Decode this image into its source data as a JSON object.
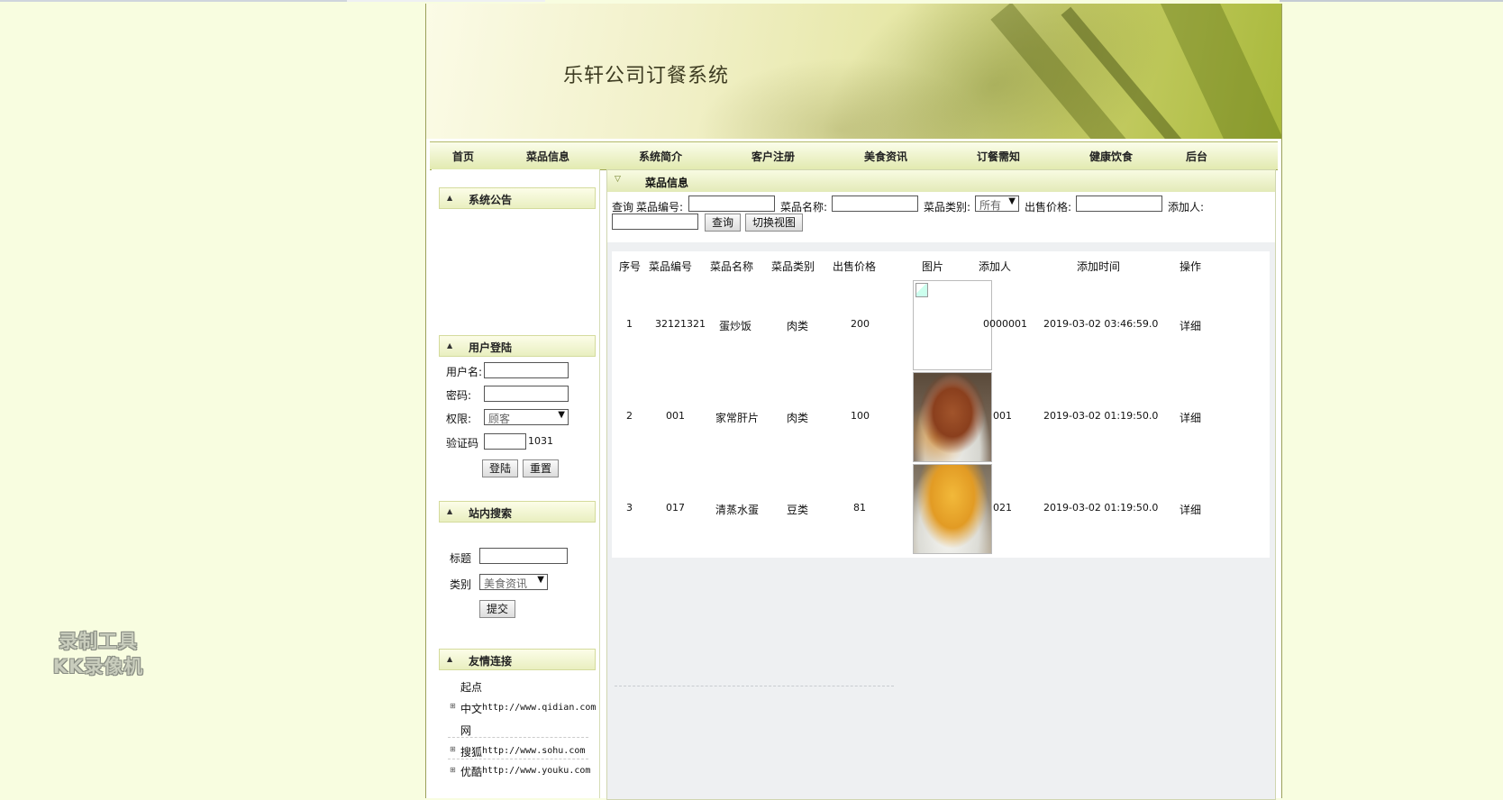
{
  "banner": {
    "title": "乐轩公司订餐系统"
  },
  "nav": [
    {
      "label": "首页"
    },
    {
      "label": "菜品信息"
    },
    {
      "label": "系统简介"
    },
    {
      "label": "客户注册"
    },
    {
      "label": "美食资讯"
    },
    {
      "label": "订餐需知"
    },
    {
      "label": "健康饮食"
    },
    {
      "label": "后台"
    }
  ],
  "sidebar": {
    "notice_title": "系统公告",
    "login": {
      "title": "用户登陆",
      "username_label": "用户名:",
      "password_label": "密码:",
      "role_label": "权限:",
      "role_value": "顾客",
      "captcha_label": "验证码",
      "captcha_code": "1031",
      "login_button": "登陆",
      "reset_button": "重置"
    },
    "search": {
      "title": "站内搜索",
      "title_label": "标题",
      "category_label": "类别",
      "category_value": "美食资讯",
      "submit_button": "提交"
    },
    "links": {
      "title": "友情连接",
      "items": [
        {
          "prefix": "起点",
          "name": "中文",
          "url": "http://www.qidian.com",
          "suffix": "网"
        },
        {
          "name": "搜狐",
          "url": "http://www.sohu.com"
        },
        {
          "name": "优酷",
          "url": "http://www.youku.com"
        }
      ]
    }
  },
  "main": {
    "title": "菜品信息",
    "search": {
      "query_label": "查询",
      "code_label": "菜品编号:",
      "name_label": "菜品名称:",
      "category_label": "菜品类别:",
      "category_value": "所有",
      "price_label": "出售价格:",
      "adder_label": "添加人:",
      "query_button": "查询",
      "switch_button": "切换视图"
    },
    "table": {
      "headers": [
        "序号",
        "菜品编号",
        "菜品名称",
        "菜品类别",
        "出售价格",
        "图片",
        "添加人",
        "添加时间",
        "操作"
      ],
      "rows": [
        {
          "no": "1",
          "code": "32121321",
          "name": "蛋炒饭",
          "category": "肉类",
          "price": "200",
          "image": "broken",
          "adder": "0000001",
          "time": "2019-03-02 03:46:59.0",
          "action": "详细"
        },
        {
          "no": "2",
          "code": "001",
          "name": "家常肝片",
          "category": "肉类",
          "price": "100",
          "image": "food-photo",
          "adder": "001",
          "time": "2019-03-02 01:19:50.0",
          "action": "详细"
        },
        {
          "no": "3",
          "code": "017",
          "name": "清蒸水蛋",
          "category": "豆类",
          "price": "81",
          "image": "food-photo",
          "adder": "021",
          "time": "2019-03-02 01:19:50.0",
          "action": "详细"
        }
      ]
    }
  },
  "watermark": {
    "line1": "录制工具",
    "line2": "KK录像机"
  }
}
